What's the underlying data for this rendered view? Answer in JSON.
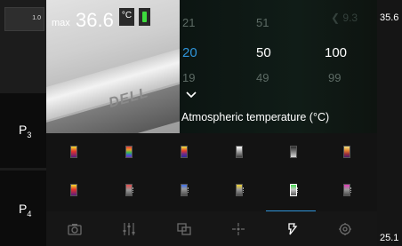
{
  "left": {
    "zoom_label": "1.0",
    "presets": [
      {
        "label": "P",
        "sub": "3"
      },
      {
        "label": "P",
        "sub": "4"
      }
    ]
  },
  "image_header": {
    "max_label": "max",
    "max_value": "36.6",
    "unit": "°C",
    "battery_color": "#3ddc3d"
  },
  "image": {
    "logo": "DELL"
  },
  "picker": {
    "columns": [
      {
        "above": "21",
        "selected": "20",
        "below": "19"
      },
      {
        "above": "51",
        "selected": "50",
        "below": "49"
      },
      {
        "above": "",
        "selected": "100",
        "below": "99"
      }
    ],
    "back_value": "9.3",
    "setting_label": "Atmospheric temperature (°C)",
    "accent": "#2f94d9"
  },
  "right_scale": {
    "top": "35.6",
    "bottom": "25.1"
  },
  "palettes": {
    "rows": [
      [
        "palette-iron",
        "palette-rainbow",
        "palette-hot-iron",
        "palette-white-hot",
        "palette-gray",
        "palette-lava"
      ],
      [
        "palette-iron-alarm",
        "palette-contrast",
        "palette-blue-alarm",
        "palette-yellow-alarm",
        "palette-green-alarm",
        "palette-magenta-alarm"
      ]
    ],
    "selected": "palette-green-alarm"
  },
  "toolbar": {
    "icons": [
      "camera-icon",
      "sliders-icon",
      "overlay-icon",
      "target-icon",
      "palette-icon",
      "gear-icon"
    ],
    "active": "palette-icon"
  }
}
